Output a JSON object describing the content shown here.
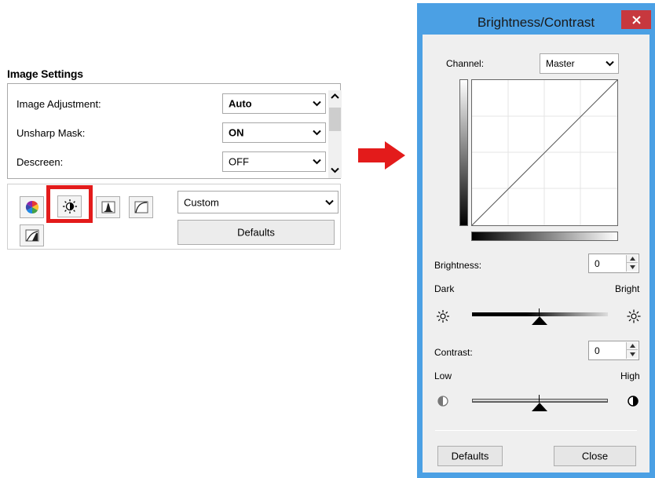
{
  "image_settings": {
    "title": "Image Settings",
    "rows": [
      {
        "label": "Image Adjustment:",
        "value": "Auto"
      },
      {
        "label": "Unsharp Mask:",
        "value": "ON"
      },
      {
        "label": "Descreen:",
        "value": "OFF"
      }
    ],
    "preset": "Custom",
    "defaults_label": "Defaults"
  },
  "dialog": {
    "title": "Brightness/Contrast",
    "channel_label": "Channel:",
    "channel_value": "Master",
    "brightness_label": "Brightness:",
    "brightness_value": "0",
    "dark_label": "Dark",
    "bright_label": "Bright",
    "contrast_label": "Contrast:",
    "contrast_value": "0",
    "low_label": "Low",
    "high_label": "High",
    "defaults_label": "Defaults",
    "close_label": "Close"
  },
  "colors": {
    "highlight": "#e31b1b",
    "arrow": "#e31b1b",
    "title_bar": "#4ba0e4",
    "close_button": "#c7383e"
  }
}
